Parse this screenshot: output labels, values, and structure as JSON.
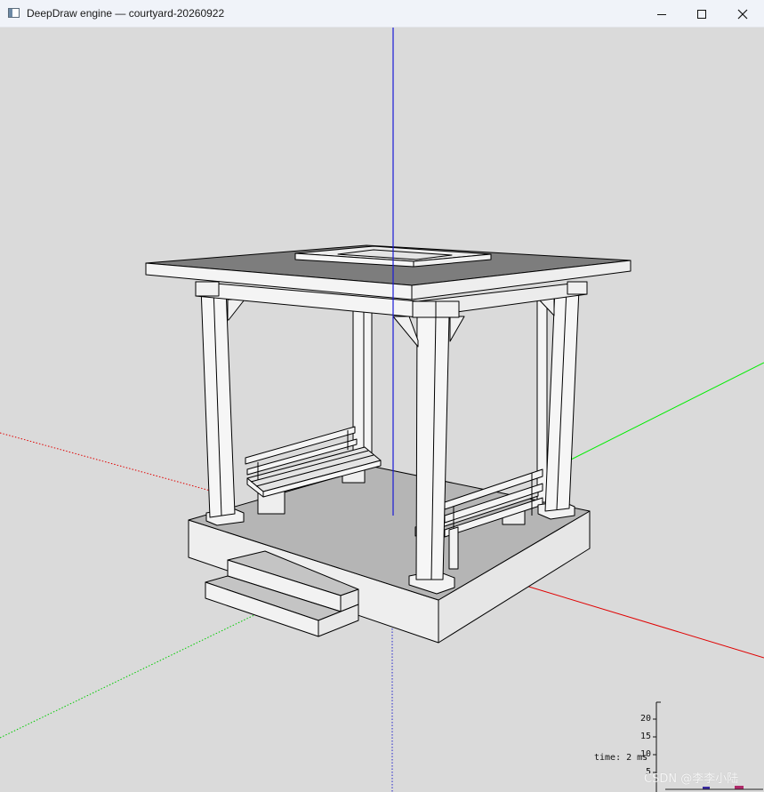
{
  "window": {
    "title": "DeepDraw engine — courtyard-20260922",
    "icon": "app-window-icon",
    "controls": [
      "minimize-icon",
      "maximize-icon",
      "close-icon"
    ]
  },
  "viewport": {
    "background": "#dadada",
    "axes": {
      "x_color": "#e00000",
      "y_color": "#00dd00",
      "z_color": "#0000cc"
    },
    "model": "gazebo with two benches and steps"
  },
  "stats": {
    "fps_ticks": [
      "20",
      "15",
      "10",
      "5"
    ],
    "time_label": "time: 2 ms"
  },
  "watermark": "CSDN @李李小陆"
}
